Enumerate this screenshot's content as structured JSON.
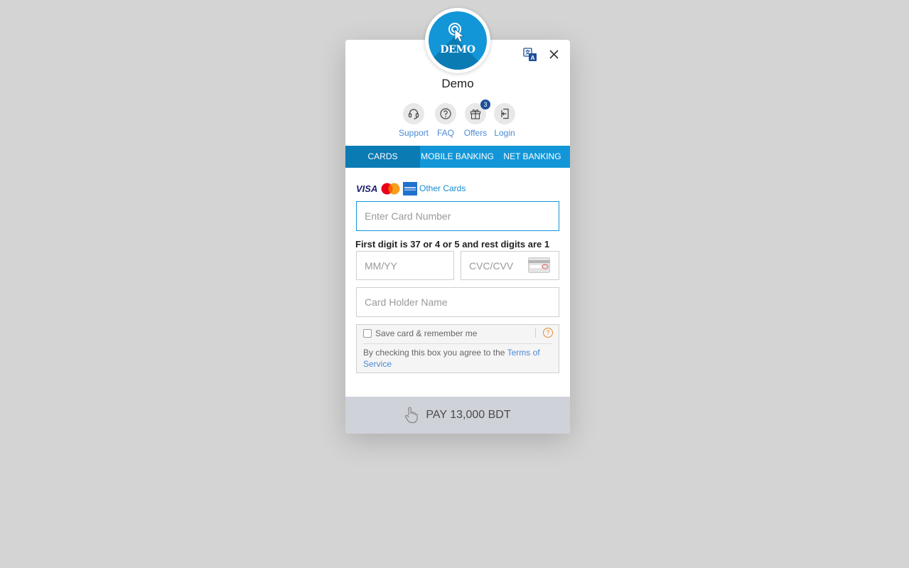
{
  "merchant": {
    "logo_text": "DEMO",
    "name": "Demo"
  },
  "quick_links": [
    {
      "label": "Support",
      "icon": "headset-icon"
    },
    {
      "label": "FAQ",
      "icon": "question-icon"
    },
    {
      "label": "Offers",
      "icon": "gift-icon",
      "badge": "3"
    },
    {
      "label": "Login",
      "icon": "login-icon"
    }
  ],
  "tabs": [
    {
      "label": "CARDS",
      "active": true
    },
    {
      "label": "MOBILE BANKING",
      "active": false
    },
    {
      "label": "NET BANKING",
      "active": false
    }
  ],
  "card_brands": {
    "visa": "VISA",
    "other_cards": "Other Cards"
  },
  "form": {
    "card_number_placeholder": "Enter Card Number",
    "hint": "First digit is 37 or 4 or 5 and rest digits are 1",
    "expiry_placeholder": "MM/YY",
    "cvc_placeholder": "CVC/CVV",
    "holder_placeholder": "Card Holder Name",
    "save_label": "Save card & remember me",
    "help_glyph": "?",
    "terms_prefix": "By checking this box you agree to the ",
    "terms_link": "Terms of Service"
  },
  "pay_button": "PAY 13,000 BDT",
  "colors": {
    "accent": "#1296d8",
    "accent_dark": "#0b7bb4",
    "link": "#4a8ad6"
  }
}
